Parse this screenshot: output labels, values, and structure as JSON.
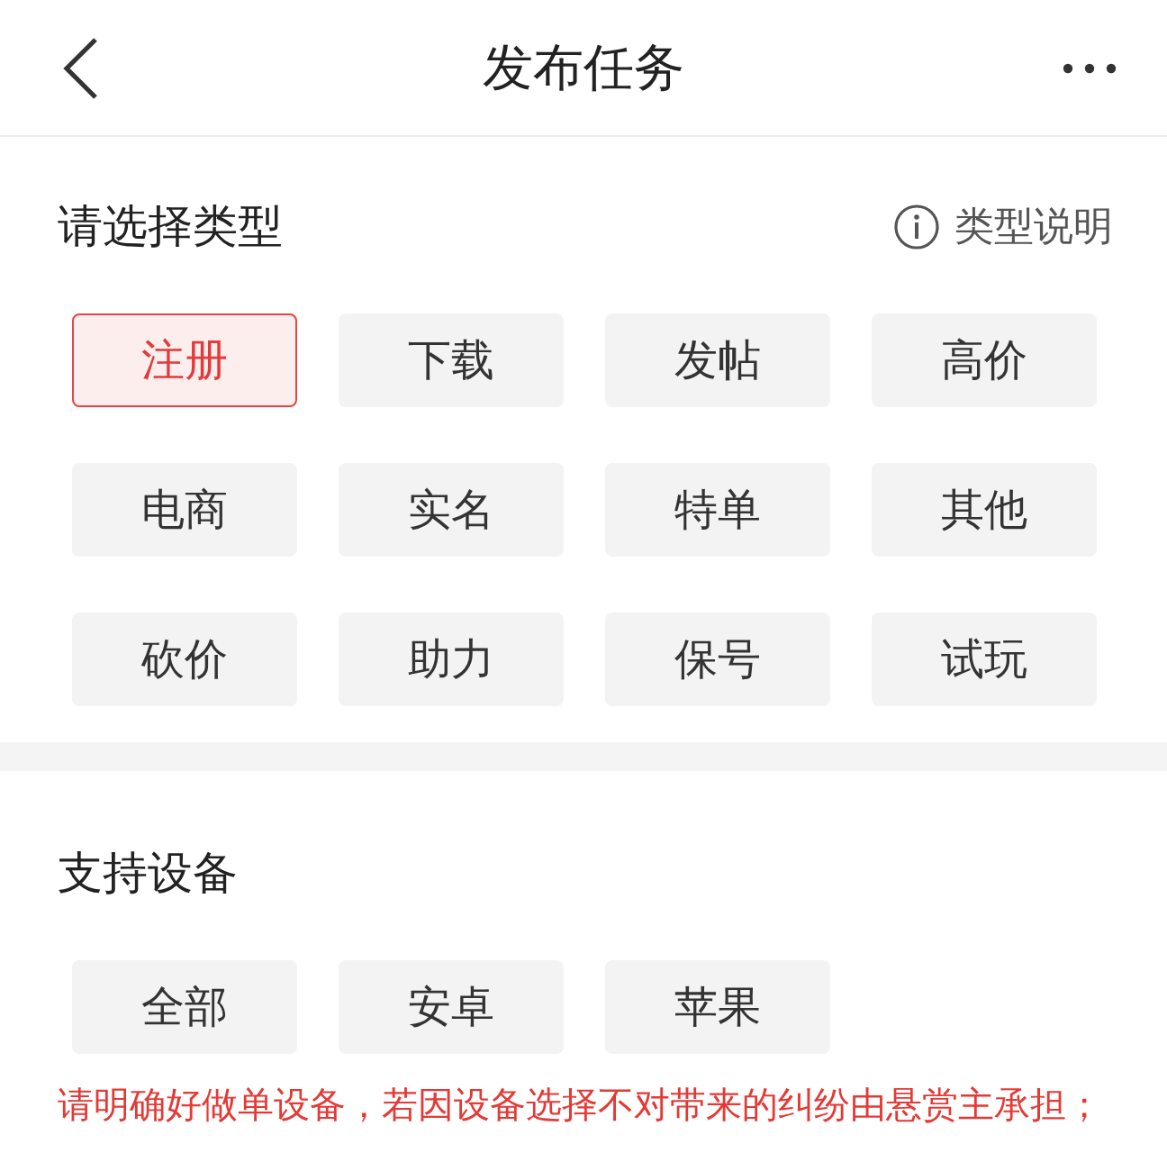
{
  "header": {
    "title": "发布任务"
  },
  "type_section": {
    "title": "请选择类型",
    "help_link": "类型说明",
    "options": [
      {
        "label": "注册",
        "selected": true
      },
      {
        "label": "下载",
        "selected": false
      },
      {
        "label": "发帖",
        "selected": false
      },
      {
        "label": "高价",
        "selected": false
      },
      {
        "label": "电商",
        "selected": false
      },
      {
        "label": "实名",
        "selected": false
      },
      {
        "label": "特单",
        "selected": false
      },
      {
        "label": "其他",
        "selected": false
      },
      {
        "label": "砍价",
        "selected": false
      },
      {
        "label": "助力",
        "selected": false
      },
      {
        "label": "保号",
        "selected": false
      },
      {
        "label": "试玩",
        "selected": false
      }
    ]
  },
  "device_section": {
    "title": "支持设备",
    "options": [
      {
        "label": "全部",
        "selected": false
      },
      {
        "label": "安卓",
        "selected": false
      },
      {
        "label": "苹果",
        "selected": false
      }
    ],
    "warning": "请明确好做单设备，若因设备选择不对带来的纠纷由悬赏主承担；"
  }
}
